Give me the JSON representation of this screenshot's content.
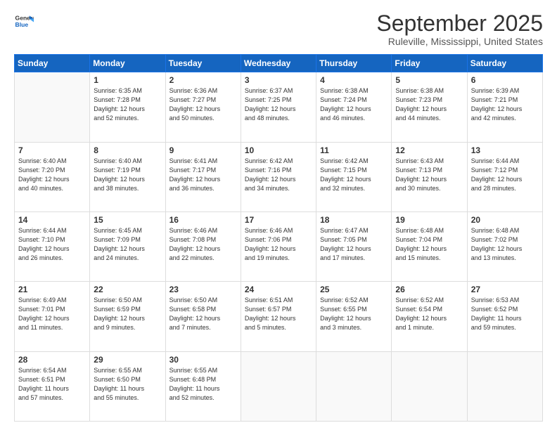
{
  "logo": {
    "line1": "General",
    "line2": "Blue"
  },
  "title": "September 2025",
  "subtitle": "Ruleville, Mississippi, United States",
  "weekdays": [
    "Sunday",
    "Monday",
    "Tuesday",
    "Wednesday",
    "Thursday",
    "Friday",
    "Saturday"
  ],
  "weeks": [
    [
      {
        "day": "",
        "info": ""
      },
      {
        "day": "1",
        "info": "Sunrise: 6:35 AM\nSunset: 7:28 PM\nDaylight: 12 hours\nand 52 minutes."
      },
      {
        "day": "2",
        "info": "Sunrise: 6:36 AM\nSunset: 7:27 PM\nDaylight: 12 hours\nand 50 minutes."
      },
      {
        "day": "3",
        "info": "Sunrise: 6:37 AM\nSunset: 7:25 PM\nDaylight: 12 hours\nand 48 minutes."
      },
      {
        "day": "4",
        "info": "Sunrise: 6:38 AM\nSunset: 7:24 PM\nDaylight: 12 hours\nand 46 minutes."
      },
      {
        "day": "5",
        "info": "Sunrise: 6:38 AM\nSunset: 7:23 PM\nDaylight: 12 hours\nand 44 minutes."
      },
      {
        "day": "6",
        "info": "Sunrise: 6:39 AM\nSunset: 7:21 PM\nDaylight: 12 hours\nand 42 minutes."
      }
    ],
    [
      {
        "day": "7",
        "info": "Sunrise: 6:40 AM\nSunset: 7:20 PM\nDaylight: 12 hours\nand 40 minutes."
      },
      {
        "day": "8",
        "info": "Sunrise: 6:40 AM\nSunset: 7:19 PM\nDaylight: 12 hours\nand 38 minutes."
      },
      {
        "day": "9",
        "info": "Sunrise: 6:41 AM\nSunset: 7:17 PM\nDaylight: 12 hours\nand 36 minutes."
      },
      {
        "day": "10",
        "info": "Sunrise: 6:42 AM\nSunset: 7:16 PM\nDaylight: 12 hours\nand 34 minutes."
      },
      {
        "day": "11",
        "info": "Sunrise: 6:42 AM\nSunset: 7:15 PM\nDaylight: 12 hours\nand 32 minutes."
      },
      {
        "day": "12",
        "info": "Sunrise: 6:43 AM\nSunset: 7:13 PM\nDaylight: 12 hours\nand 30 minutes."
      },
      {
        "day": "13",
        "info": "Sunrise: 6:44 AM\nSunset: 7:12 PM\nDaylight: 12 hours\nand 28 minutes."
      }
    ],
    [
      {
        "day": "14",
        "info": "Sunrise: 6:44 AM\nSunset: 7:10 PM\nDaylight: 12 hours\nand 26 minutes."
      },
      {
        "day": "15",
        "info": "Sunrise: 6:45 AM\nSunset: 7:09 PM\nDaylight: 12 hours\nand 24 minutes."
      },
      {
        "day": "16",
        "info": "Sunrise: 6:46 AM\nSunset: 7:08 PM\nDaylight: 12 hours\nand 22 minutes."
      },
      {
        "day": "17",
        "info": "Sunrise: 6:46 AM\nSunset: 7:06 PM\nDaylight: 12 hours\nand 19 minutes."
      },
      {
        "day": "18",
        "info": "Sunrise: 6:47 AM\nSunset: 7:05 PM\nDaylight: 12 hours\nand 17 minutes."
      },
      {
        "day": "19",
        "info": "Sunrise: 6:48 AM\nSunset: 7:04 PM\nDaylight: 12 hours\nand 15 minutes."
      },
      {
        "day": "20",
        "info": "Sunrise: 6:48 AM\nSunset: 7:02 PM\nDaylight: 12 hours\nand 13 minutes."
      }
    ],
    [
      {
        "day": "21",
        "info": "Sunrise: 6:49 AM\nSunset: 7:01 PM\nDaylight: 12 hours\nand 11 minutes."
      },
      {
        "day": "22",
        "info": "Sunrise: 6:50 AM\nSunset: 6:59 PM\nDaylight: 12 hours\nand 9 minutes."
      },
      {
        "day": "23",
        "info": "Sunrise: 6:50 AM\nSunset: 6:58 PM\nDaylight: 12 hours\nand 7 minutes."
      },
      {
        "day": "24",
        "info": "Sunrise: 6:51 AM\nSunset: 6:57 PM\nDaylight: 12 hours\nand 5 minutes."
      },
      {
        "day": "25",
        "info": "Sunrise: 6:52 AM\nSunset: 6:55 PM\nDaylight: 12 hours\nand 3 minutes."
      },
      {
        "day": "26",
        "info": "Sunrise: 6:52 AM\nSunset: 6:54 PM\nDaylight: 12 hours\nand 1 minute."
      },
      {
        "day": "27",
        "info": "Sunrise: 6:53 AM\nSunset: 6:52 PM\nDaylight: 11 hours\nand 59 minutes."
      }
    ],
    [
      {
        "day": "28",
        "info": "Sunrise: 6:54 AM\nSunset: 6:51 PM\nDaylight: 11 hours\nand 57 minutes."
      },
      {
        "day": "29",
        "info": "Sunrise: 6:55 AM\nSunset: 6:50 PM\nDaylight: 11 hours\nand 55 minutes."
      },
      {
        "day": "30",
        "info": "Sunrise: 6:55 AM\nSunset: 6:48 PM\nDaylight: 11 hours\nand 52 minutes."
      },
      {
        "day": "",
        "info": ""
      },
      {
        "day": "",
        "info": ""
      },
      {
        "day": "",
        "info": ""
      },
      {
        "day": "",
        "info": ""
      }
    ]
  ]
}
